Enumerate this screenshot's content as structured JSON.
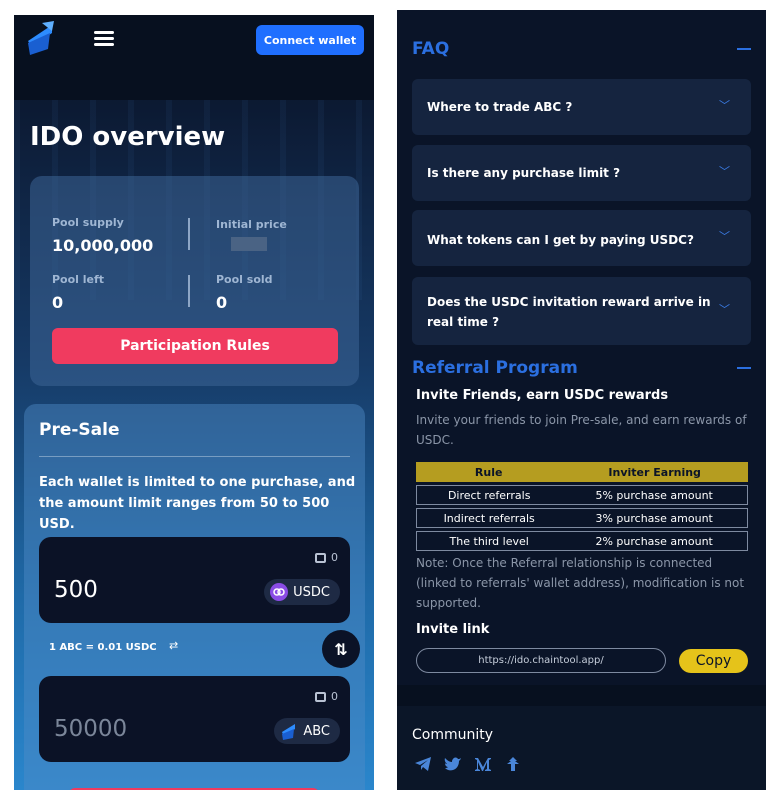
{
  "header": {
    "connect_label": "Connect wallet"
  },
  "overview": {
    "title": "IDO overview",
    "pool_supply_label": "Pool supply",
    "pool_supply_value": "10,000,000",
    "initial_price_label": "Initial price",
    "pool_left_label": "Pool left",
    "pool_left_value": "0",
    "pool_sold_label": "Pool sold",
    "pool_sold_value": "0",
    "rules_button": "Participation Rules"
  },
  "presale": {
    "title": "Pre-Sale",
    "description": "Each wallet is limited to one purchase, and the amount limit ranges from 50 to 500 USD.",
    "pay": {
      "balance": "0",
      "amount": "500",
      "token": "USDC"
    },
    "rate": "1 ABC = 0.01 USDC",
    "receive": {
      "balance": "0",
      "amount": "50000",
      "token": "ABC"
    }
  },
  "faq": {
    "title": "FAQ",
    "items": [
      "Where to trade ABC ?",
      "Is there any purchase limit ?",
      "What tokens can I get by paying USDC?",
      "Does the USDC invitation reward arrive in real time ?"
    ]
  },
  "referral": {
    "title": "Referral Program",
    "subtitle": "Invite Friends, earn USDC rewards",
    "description": "Invite your friends to join Pre-sale, and earn rewards of USDC.",
    "table": {
      "headers": [
        "Rule",
        "Inviter Earning"
      ],
      "rows": [
        [
          "Direct referrals",
          "5% purchase amount"
        ],
        [
          "Indirect referrals",
          "3% purchase amount"
        ],
        [
          "The third level",
          "2% purchase amount"
        ]
      ]
    },
    "note": "Note: Once the Referral relationship is connected (linked to referrals' wallet address), modification is not supported.",
    "invite_link_label": "Invite link",
    "invite_link": "https://ido.chaintool.app/",
    "copy_label": "Copy"
  },
  "footer": {
    "community_label": "Community",
    "socials": [
      "telegram-icon",
      "twitter-icon",
      "medium-icon",
      "linktree-icon"
    ]
  },
  "colors": {
    "accent": "#1f6fff",
    "danger": "#f03b5f",
    "gold": "#e5c31a",
    "table_header": "#b59d20"
  }
}
